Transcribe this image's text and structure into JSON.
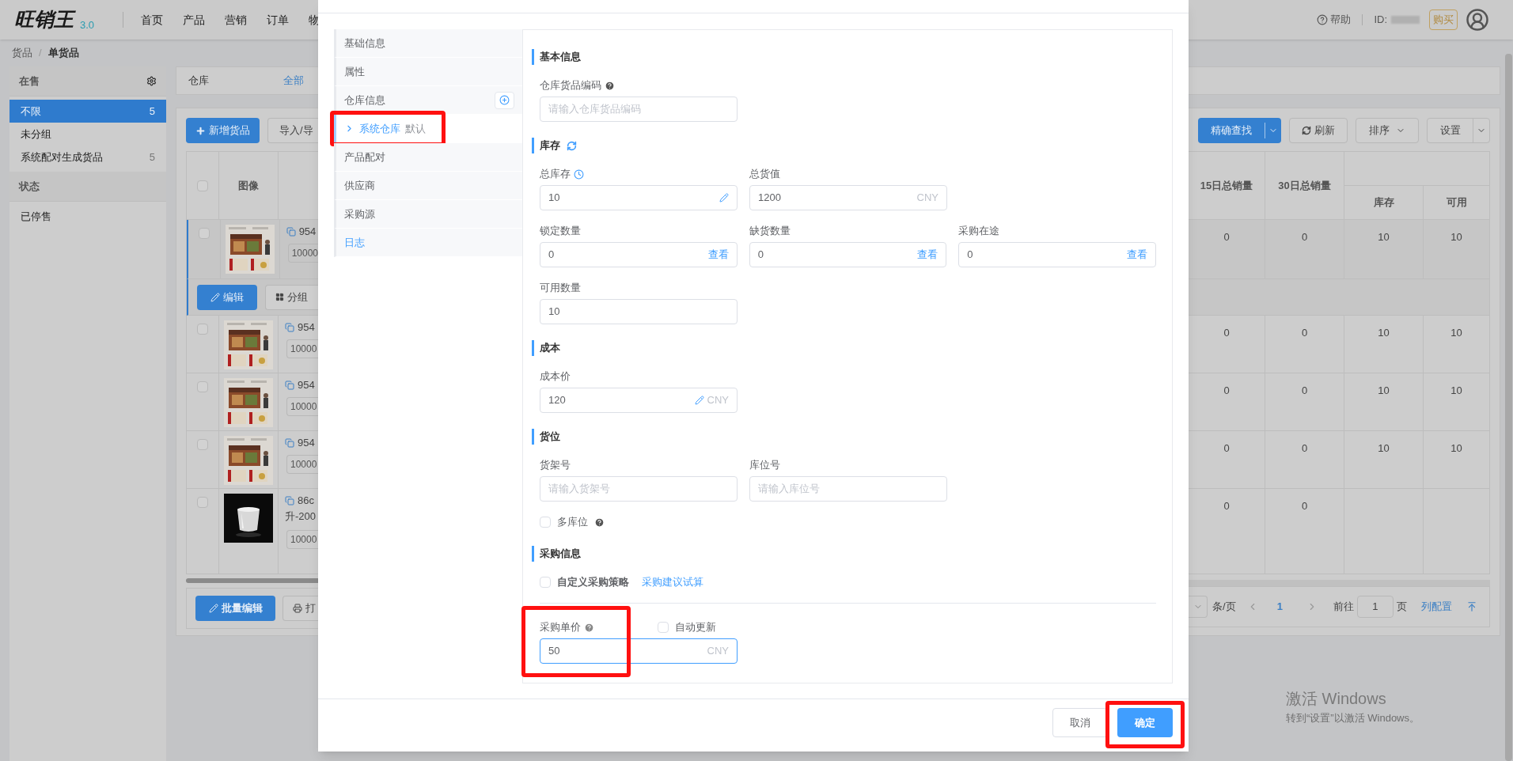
{
  "app": {
    "logo": "旺销王",
    "version": "3.0",
    "nav": [
      "首页",
      "产品",
      "营销",
      "订单",
      "物"
    ],
    "help": "帮助",
    "id_label": "ID:",
    "buy": "购买"
  },
  "breadcrumb": {
    "items": [
      "货品",
      "单货品"
    ],
    "separator": "/"
  },
  "sidebar": [
    {
      "title": "在售",
      "gear": true,
      "items": [
        {
          "label": "不限",
          "count": "5",
          "selected": true
        },
        {
          "label": "未分组",
          "selected": false
        },
        {
          "label": "系统配对生成货品",
          "count": "5",
          "selected": false
        }
      ]
    },
    {
      "title": "状态",
      "gear": false,
      "items": [
        {
          "label": "已停售",
          "selected": false
        }
      ]
    }
  ],
  "filter": {
    "label": "仓库",
    "value": "全部"
  },
  "toolbar_left": [
    {
      "label": "新增货品",
      "kind": "primary"
    },
    {
      "label": "导入/导",
      "kind": "default"
    }
  ],
  "toolbar_right": [
    {
      "label": "精确查找",
      "kind": "split-primary"
    },
    {
      "label": "刷新",
      "kind": "refresh"
    },
    {
      "label": "排序",
      "kind": "dropdown"
    },
    {
      "label": "设置",
      "kind": "split"
    }
  ],
  "table": {
    "image_column": "图像",
    "columns": [
      "15日总销量",
      "30日总销量"
    ],
    "sub_columns": [
      "库存",
      "可用"
    ],
    "header_checked": false,
    "rows": [
      {
        "code": "954",
        "qty": "10000",
        "sales_15": "0",
        "sales_30": "0",
        "stock": "10",
        "available": "10",
        "selected": true,
        "checked": false
      },
      {
        "code": "954",
        "qty": "10000",
        "sales_15": "0",
        "sales_30": "0",
        "stock": "10",
        "available": "10",
        "selected": false,
        "checked": false
      },
      {
        "code": "954",
        "qty": "10000",
        "sales_15": "0",
        "sales_30": "0",
        "stock": "10",
        "available": "10",
        "selected": false,
        "checked": false
      },
      {
        "code": "954",
        "qty": "10000",
        "sales_15": "0",
        "sales_30": "0",
        "stock": "10",
        "available": "10",
        "selected": false,
        "checked": false
      },
      {
        "code": "86c",
        "name": "升-200",
        "qty": "10000",
        "sales_15": "0",
        "sales_30": "0",
        "selected": false,
        "checked": false
      }
    ],
    "row_actions": [
      {
        "label": "编辑",
        "kind": "primary"
      },
      {
        "label": "分组",
        "kind": "default"
      }
    ]
  },
  "footer": {
    "batch_edit": "批量编辑",
    "print": "打"
  },
  "pagination": {
    "per_page": "条/页",
    "page": "1",
    "goto": "前往",
    "goto_value": "1",
    "page_unit": "页",
    "column_config": "列配置"
  },
  "modal": {
    "nav": [
      {
        "label": "基础信息",
        "kind": "item",
        "selected": false
      },
      {
        "label": "属性",
        "kind": "item",
        "selected": false
      },
      {
        "label": "仓库信息",
        "kind": "add",
        "selected": false
      },
      {
        "label": "系统仓库",
        "tag": "默认",
        "kind": "sub",
        "selected": true,
        "highlighted": true
      },
      {
        "label": "产品配对",
        "kind": "item",
        "selected": false
      },
      {
        "label": "供应商",
        "kind": "item",
        "selected": false
      },
      {
        "label": "采购源",
        "kind": "item",
        "selected": false
      },
      {
        "label": "日志",
        "kind": "link",
        "selected": false
      }
    ],
    "sections": [
      {
        "title": "基本信息",
        "rows": [
          {
            "kind": "fields",
            "fields": [
              {
                "label": "仓库货品编码",
                "hint": true,
                "placeholder": "请输入仓库货品编码"
              }
            ]
          }
        ]
      },
      {
        "title": "库存",
        "refresh": true,
        "rows": [
          {
            "kind": "fields",
            "fields": [
              {
                "label": "总库存",
                "timer": true,
                "value": "10",
                "edit": true
              },
              {
                "label": "总货值",
                "value": "1200",
                "suffix": "CNY"
              }
            ]
          },
          {
            "kind": "fields",
            "fields": [
              {
                "label": "锁定数量",
                "value": "0",
                "action": "查看"
              },
              {
                "label": "缺货数量",
                "value": "0",
                "action": "查看"
              },
              {
                "label": "采购在途",
                "value": "0",
                "action": "查看"
              }
            ]
          },
          {
            "kind": "fields",
            "fields": [
              {
                "label": "可用数量",
                "value": "10"
              }
            ]
          }
        ]
      },
      {
        "title": "成本",
        "rows": [
          {
            "kind": "fields",
            "fields": [
              {
                "label": "成本价",
                "value": "120",
                "edit": true,
                "suffix": "CNY"
              }
            ]
          }
        ]
      },
      {
        "title": "货位",
        "rows": [
          {
            "kind": "fields",
            "fields": [
              {
                "label": "货架号",
                "placeholder": "请输入货架号"
              },
              {
                "label": "库位号",
                "placeholder": "请输入库位号"
              }
            ]
          },
          {
            "kind": "checkbox",
            "label": "多库位",
            "checked": false,
            "help": true
          }
        ]
      },
      {
        "title": "采购信息",
        "rows": [
          {
            "kind": "checkbox",
            "label": "自定义采购策略",
            "checked": false,
            "bold": true,
            "link": "采购建议试算"
          },
          {
            "kind": "price",
            "label": "采购单价",
            "help": true,
            "auto": {
              "label": "自动更新",
              "checked": false
            },
            "value": "50",
            "suffix": "CNY",
            "focused": true,
            "highlighted": true
          }
        ]
      }
    ],
    "buttons": [
      {
        "label": "取消",
        "kind": "default"
      },
      {
        "label": "确定",
        "kind": "primary",
        "highlighted": true
      }
    ]
  },
  "os_notice": {
    "title": "激活 Windows",
    "text": "转到“设置”以激活 Windows。"
  }
}
